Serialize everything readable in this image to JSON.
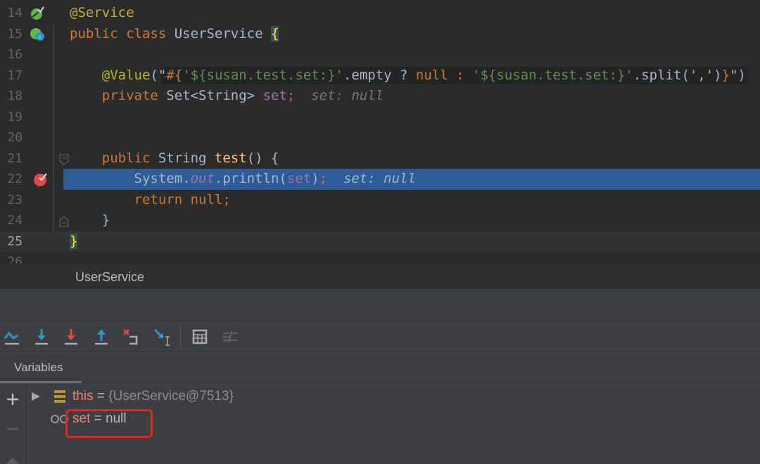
{
  "editor": {
    "lines": [
      {
        "num": "14",
        "tokens": [
          {
            "t": "@Service",
            "c": "anno"
          }
        ]
      },
      {
        "num": "15",
        "tokens": [
          {
            "t": "public class ",
            "c": "kw"
          },
          {
            "t": "UserService ",
            "c": "plain"
          },
          {
            "t": "{",
            "c": "brace"
          }
        ]
      },
      {
        "num": "16",
        "tokens": []
      },
      {
        "num": "17",
        "tokens": [
          {
            "t": "    "
          },
          {
            "t": "@Value",
            "c": "anno"
          },
          {
            "t": "(\"",
            "c": "plain"
          },
          {
            "t": "#{",
            "c": "bracec"
          },
          {
            "t": "'${susan.test.set:}'",
            "c": "str"
          },
          {
            "t": ".empty ? ",
            "c": "plain"
          },
          {
            "t": "null",
            "c": "kw"
          },
          {
            "t": " : ",
            "c": "kw"
          },
          {
            "t": "'${susan.test.set:}'",
            "c": "str"
          },
          {
            "t": ".split(',')",
            "c": "plain"
          },
          {
            "t": "}",
            "c": "bracec"
          },
          {
            "t": "\")",
            "c": "plain"
          }
        ]
      },
      {
        "num": "18",
        "tokens": [
          {
            "t": "    "
          },
          {
            "t": "private ",
            "c": "kw"
          },
          {
            "t": "Set<String> ",
            "c": "plain"
          },
          {
            "t": "set",
            "c": "field"
          },
          {
            "t": ";",
            "c": "kw"
          },
          {
            "t": "  set: null",
            "c": "hint"
          }
        ]
      },
      {
        "num": "19",
        "tokens": []
      },
      {
        "num": "20",
        "tokens": []
      },
      {
        "num": "21",
        "tokens": [
          {
            "t": "    "
          },
          {
            "t": "public ",
            "c": "kw"
          },
          {
            "t": "String ",
            "c": "plain"
          },
          {
            "t": "test",
            "c": "fn"
          },
          {
            "t": "() {",
            "c": "plain"
          }
        ]
      },
      {
        "num": "22",
        "tokens": [
          {
            "t": "        "
          },
          {
            "t": "System.",
            "c": "plain"
          },
          {
            "t": "out",
            "c": "static"
          },
          {
            "t": ".println(",
            "c": "plain"
          },
          {
            "t": "set",
            "c": "field"
          },
          {
            "t": ")",
            "c": "plain"
          },
          {
            "t": ";",
            "c": "kw"
          },
          {
            "t": "  set: null",
            "c": "hint"
          }
        ]
      },
      {
        "num": "23",
        "tokens": [
          {
            "t": "        "
          },
          {
            "t": "return null;",
            "c": "kw"
          }
        ]
      },
      {
        "num": "24",
        "tokens": [
          {
            "t": "    "
          },
          {
            "t": "}",
            "c": "plain"
          }
        ]
      },
      {
        "num": "25",
        "tokens": [
          {
            "t": "}",
            "c": "brace"
          }
        ]
      },
      {
        "num": "26",
        "tokens": []
      }
    ],
    "current_line": "25",
    "execution_line": "22",
    "breakpoint_line": "22"
  },
  "breadcrumb": {
    "label": "UserService"
  },
  "toolbar": {
    "buttons": [
      {
        "name": "step-over",
        "icon": "step-over-icon"
      },
      {
        "name": "step-into",
        "icon": "step-into-icon"
      },
      {
        "name": "force-step-into",
        "icon": "force-step-into-icon"
      },
      {
        "name": "step-out",
        "icon": "step-out-icon"
      },
      {
        "name": "drop-frame",
        "icon": "drop-frame-icon"
      },
      {
        "name": "run-to-cursor",
        "icon": "run-to-cursor-icon"
      },
      {
        "name": "evaluate-expression",
        "icon": "calculator-icon"
      },
      {
        "name": "trace-stream",
        "icon": "trace-icon"
      }
    ]
  },
  "variables": {
    "tab_label": "Variables",
    "items": [
      {
        "name": "this",
        "eq": " = ",
        "value": "{UserService@7513}"
      },
      {
        "name": "set",
        "eq": " = ",
        "value": "null"
      }
    ]
  },
  "colors": {
    "highlight": "#2d5c99",
    "annotation_box": "#e8241c",
    "breakpoint": "#db4b4b"
  }
}
